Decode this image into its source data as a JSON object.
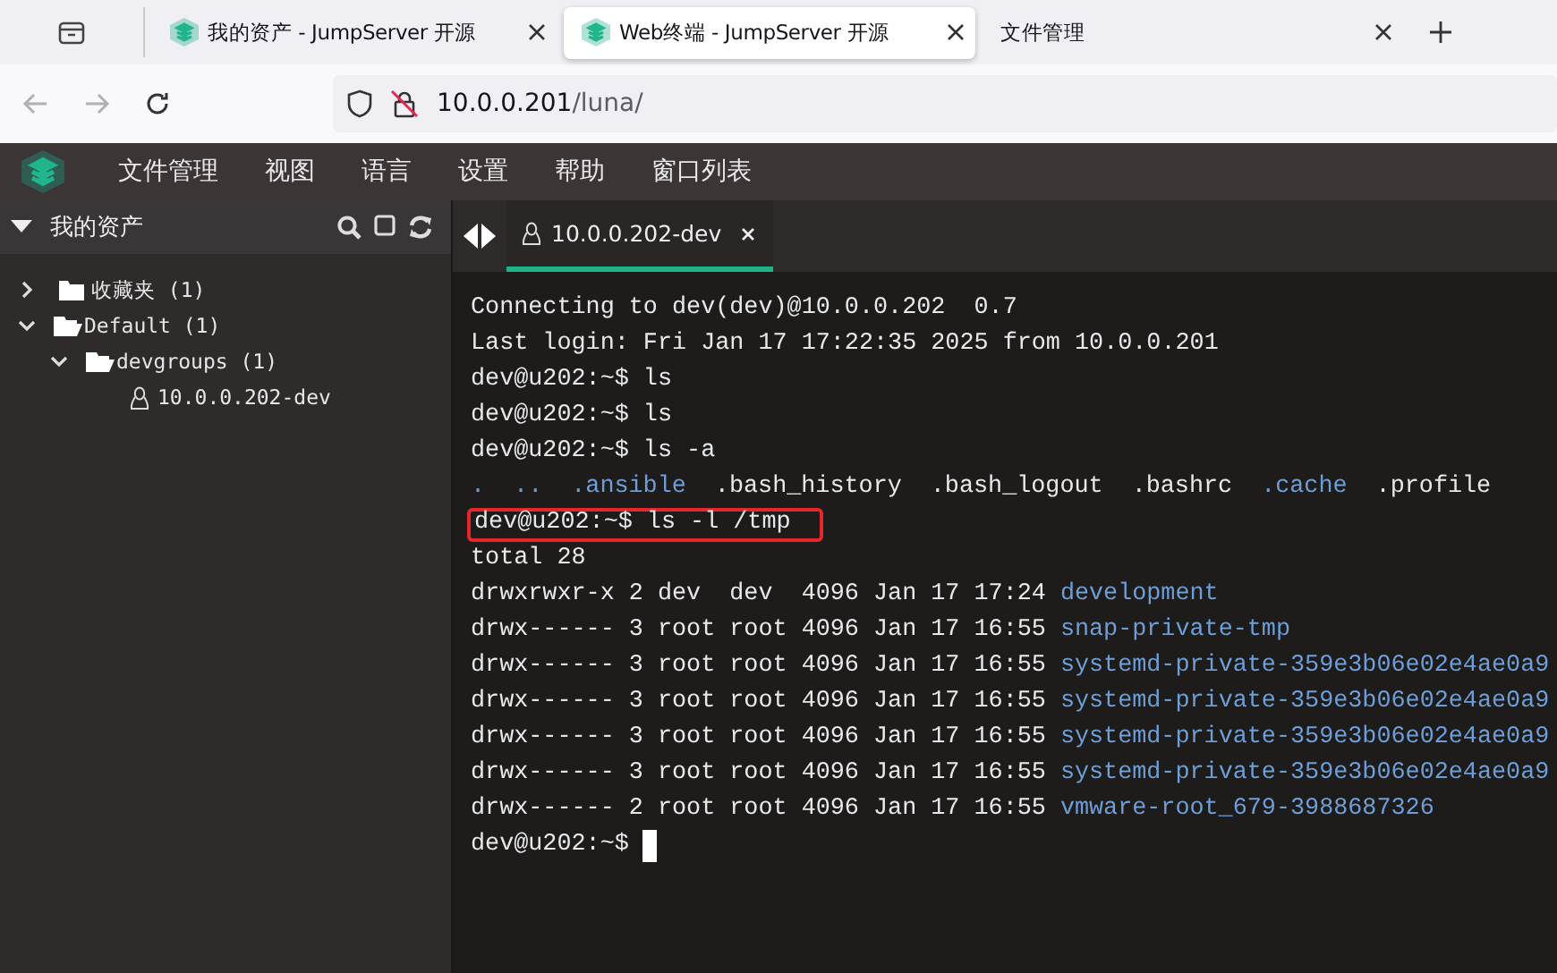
{
  "browser": {
    "tabs": [
      {
        "title": "我的资产 - JumpServer 开源",
        "has_icon": true,
        "selected": false
      },
      {
        "title": "Web终端 - JumpServer 开源",
        "has_icon": true,
        "selected": true
      },
      {
        "title": "文件管理",
        "has_icon": false,
        "selected": false
      }
    ],
    "url_host": "10.0.0.201",
    "url_path": "/luna/"
  },
  "menu": [
    "文件管理",
    "视图",
    "语言",
    "设置",
    "帮助",
    "窗口列表"
  ],
  "sidebar": {
    "title": "我的资产",
    "tree": [
      {
        "label": "收藏夹 (1)",
        "kind": "folder",
        "expanded": false
      },
      {
        "label": "Default (1)",
        "kind": "folder",
        "expanded": true,
        "children": [
          {
            "label": "devgroups (1)",
            "kind": "folder",
            "expanded": true,
            "children": [
              {
                "label": "10.0.0.202-dev",
                "kind": "host"
              }
            ]
          }
        ]
      }
    ]
  },
  "session_tabs": [
    {
      "label": "10.0.0.202-dev",
      "selected": true
    }
  ],
  "terminal": {
    "lines": [
      {
        "highlighted": false,
        "cursor": false,
        "segments": [
          {
            "kind": "plain",
            "text": "Connecting to dev(dev)@10.0.0.202  0.7"
          }
        ]
      },
      {
        "highlighted": false,
        "cursor": false,
        "segments": [
          {
            "kind": "plain",
            "text": "Last login: Fri Jan 17 17:22:35 2025 from 10.0.0.201"
          }
        ]
      },
      {
        "highlighted": false,
        "cursor": false,
        "segments": [
          {
            "kind": "plain",
            "text": "dev@u202:~$ ls"
          }
        ]
      },
      {
        "highlighted": false,
        "cursor": false,
        "segments": [
          {
            "kind": "plain",
            "text": "dev@u202:~$ ls"
          }
        ]
      },
      {
        "highlighted": false,
        "cursor": false,
        "segments": [
          {
            "kind": "plain",
            "text": "dev@u202:~$ ls -a"
          }
        ]
      },
      {
        "highlighted": false,
        "cursor": false,
        "segments": [
          {
            "kind": "dir",
            "text": "."
          },
          {
            "kind": "dir",
            "text": ".."
          },
          {
            "kind": "dir",
            "text": ".ansible"
          },
          {
            "kind": "plain",
            "text": ".bash_history"
          },
          {
            "kind": "plain",
            "text": ".bash_logout"
          },
          {
            "kind": "plain",
            "text": ".bashrc"
          },
          {
            "kind": "dir",
            "text": ".cache"
          },
          {
            "kind": "plain",
            "text": ".profile"
          }
        ]
      },
      {
        "highlighted": true,
        "cursor": false,
        "segments": [
          {
            "kind": "plain",
            "text": "dev@u202:~$ ls -l /tmp"
          }
        ]
      },
      {
        "highlighted": false,
        "cursor": false,
        "segments": [
          {
            "kind": "plain",
            "text": "total 28"
          }
        ]
      },
      {
        "highlighted": false,
        "cursor": false,
        "segments": [
          {
            "kind": "plain",
            "text": "drwxrwxr-x 2 dev  dev  4096 Jan 17 17:24"
          },
          {
            "kind": "dir",
            "text": "development"
          }
        ]
      },
      {
        "highlighted": false,
        "cursor": false,
        "segments": [
          {
            "kind": "plain",
            "text": "drwx------ 3 root root 4096 Jan 17 16:55"
          },
          {
            "kind": "dir",
            "text": "snap-private-tmp"
          }
        ]
      },
      {
        "highlighted": false,
        "cursor": false,
        "segments": [
          {
            "kind": "plain",
            "text": "drwx------ 3 root root 4096 Jan 17 16:55"
          },
          {
            "kind": "dir",
            "text": "systemd-private-359e3b06e02e4ae0a9"
          }
        ]
      },
      {
        "highlighted": false,
        "cursor": false,
        "segments": [
          {
            "kind": "plain",
            "text": "drwx------ 3 root root 4096 Jan 17 16:55"
          },
          {
            "kind": "dir",
            "text": "systemd-private-359e3b06e02e4ae0a9"
          }
        ]
      },
      {
        "highlighted": false,
        "cursor": false,
        "segments": [
          {
            "kind": "plain",
            "text": "drwx------ 3 root root 4096 Jan 17 16:55"
          },
          {
            "kind": "dir",
            "text": "systemd-private-359e3b06e02e4ae0a9"
          }
        ]
      },
      {
        "highlighted": false,
        "cursor": false,
        "segments": [
          {
            "kind": "plain",
            "text": "drwx------ 3 root root 4096 Jan 17 16:55"
          },
          {
            "kind": "dir",
            "text": "systemd-private-359e3b06e02e4ae0a9"
          }
        ]
      },
      {
        "highlighted": false,
        "cursor": false,
        "segments": [
          {
            "kind": "plain",
            "text": "drwx------ 2 root root 4096 Jan 17 16:55"
          },
          {
            "kind": "dir",
            "text": "vmware-root_679-3988687326"
          }
        ]
      },
      {
        "highlighted": false,
        "cursor": true,
        "segments": [
          {
            "kind": "plain",
            "text": "dev@u202:~$"
          }
        ]
      }
    ]
  }
}
